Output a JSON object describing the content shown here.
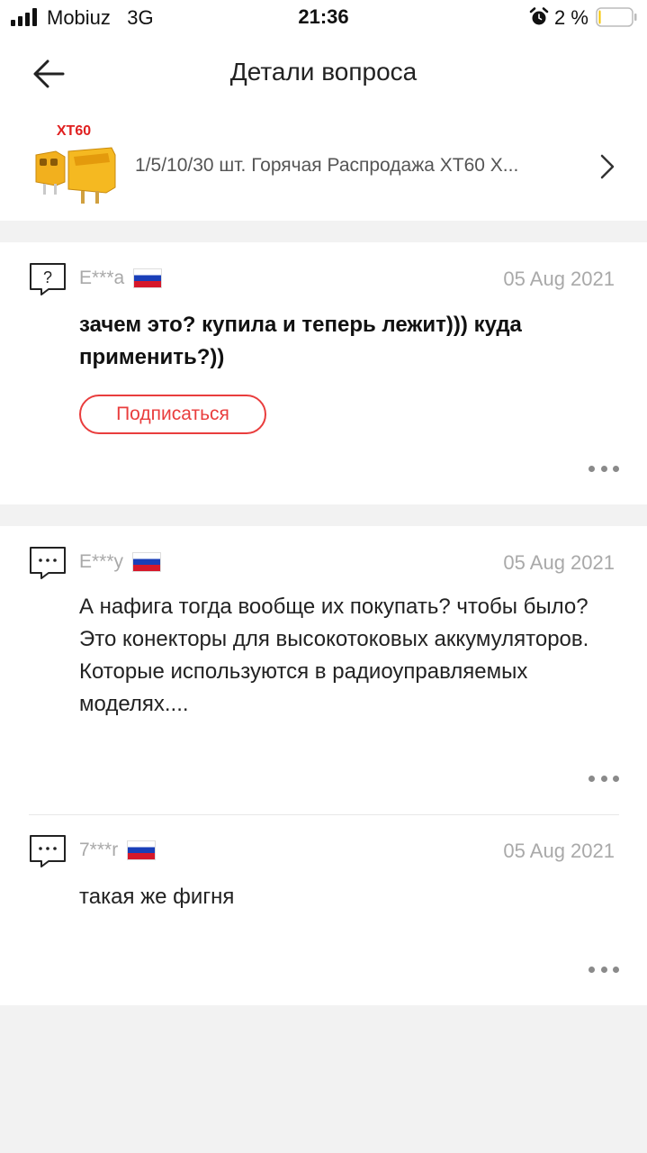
{
  "status_bar": {
    "carrier": "Mobiuz",
    "network": "3G",
    "time": "21:36",
    "battery_percent": "2 %",
    "battery_level": 0.02,
    "icons": [
      "signal-icon",
      "alarm-icon",
      "battery-icon"
    ]
  },
  "header": {
    "title": "Детали вопроса",
    "back_icon": "back-arrow-icon"
  },
  "product": {
    "title": "1/5/10/30 шт. Горячая Распродажа XT60 X...",
    "image_label": "XT60",
    "chevron_icon": "chevron-right-icon"
  },
  "question": {
    "user": "E***a",
    "country": "Russia",
    "date": "05 Aug 2021",
    "text": "зачем это? купила и теперь лежит))) куда применить?))",
    "subscribe_label": "Подписаться",
    "icon": "question-bubble-icon"
  },
  "answers": [
    {
      "user": "E***y",
      "country": "Russia",
      "date": "05 Aug 2021",
      "text": "А нафига тогда вообще их покупать? чтобы было?  Это конекторы для высокотоковых аккумуляторов. Которые используются в радиоуправляемых моделях....",
      "icon": "comment-bubble-icon"
    },
    {
      "user": "7***r",
      "country": "Russia",
      "date": "05 Aug 2021",
      "text": "такая же фигня",
      "icon": "comment-bubble-icon"
    }
  ],
  "colors": {
    "accent": "#e93d3d",
    "muted_text": "#a9a9a9",
    "background": "#f2f2f2"
  }
}
